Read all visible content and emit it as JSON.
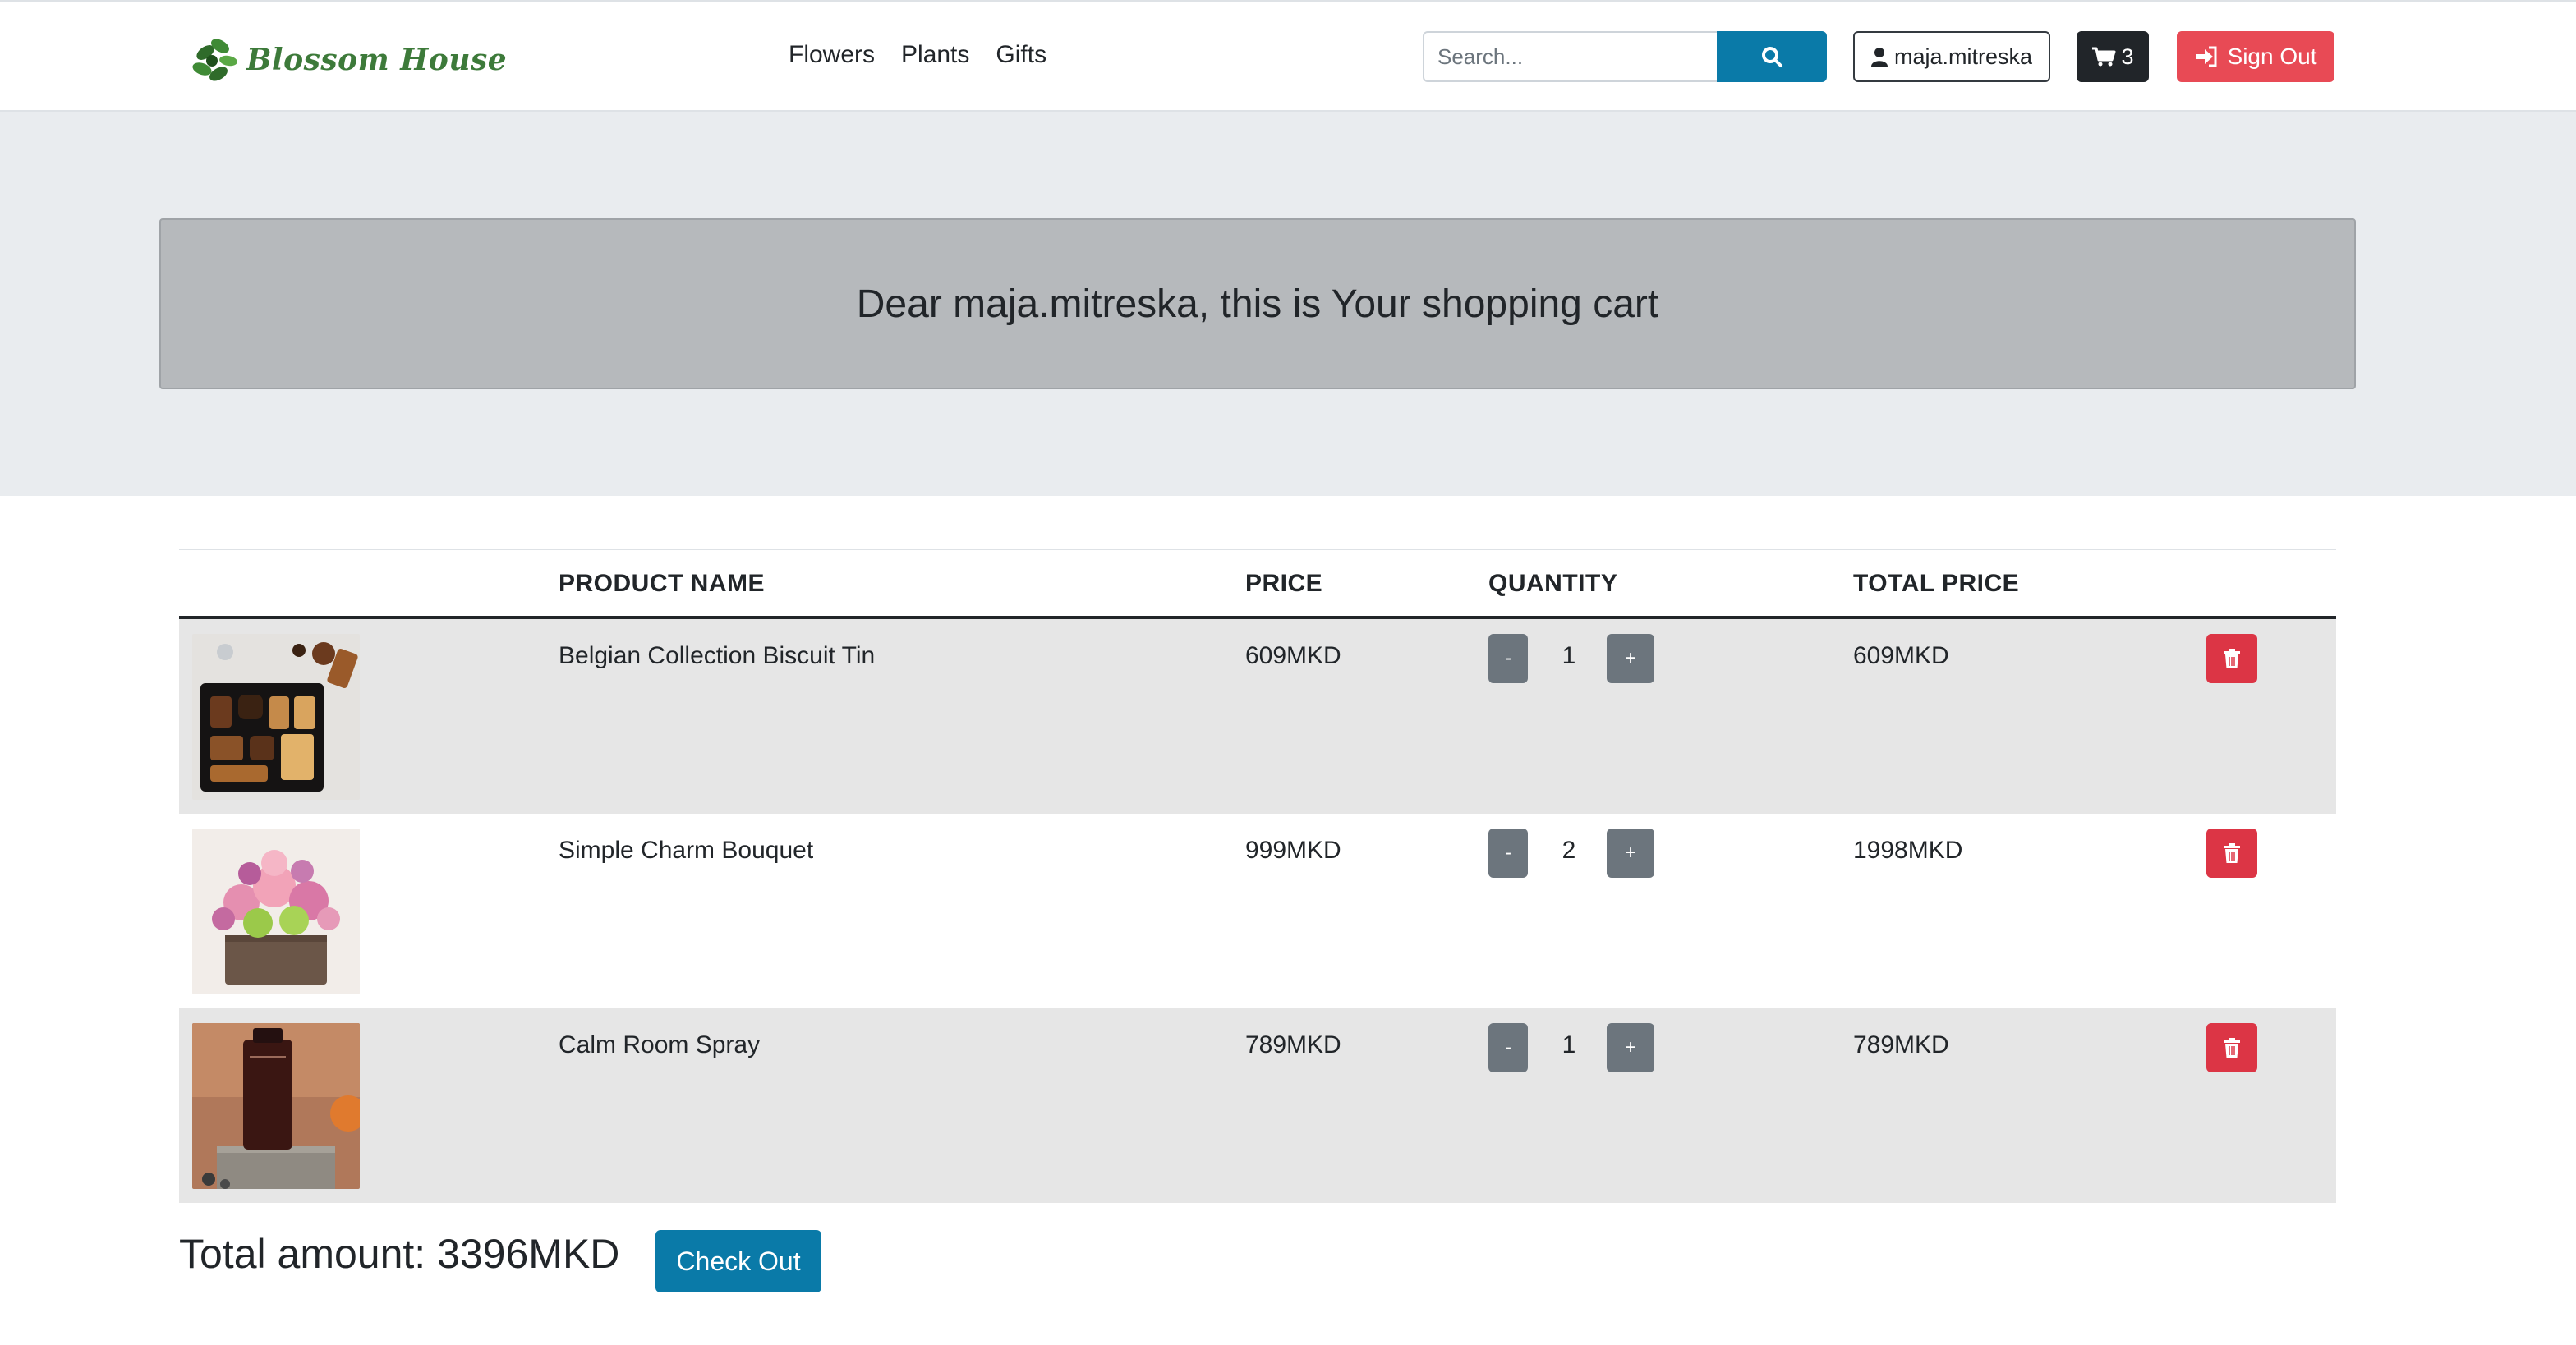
{
  "brand": {
    "name": "Blossom House"
  },
  "nav": {
    "links": [
      "Flowers",
      "Plants",
      "Gifts"
    ]
  },
  "search": {
    "placeholder": "Search...",
    "value": ""
  },
  "user": {
    "username": "maja.mitreska"
  },
  "cart_badge": {
    "count": "3"
  },
  "auth": {
    "sign_out_label": "Sign Out"
  },
  "hero": {
    "title": "Dear maja.mitreska, this is Your shopping cart"
  },
  "table": {
    "headers": [
      "PRODUCT NAME",
      "PRICE",
      "QUANTITY",
      "TOTAL PRICE"
    ],
    "rows": [
      {
        "name": "Belgian Collection Biscuit Tin",
        "price": "609MKD",
        "quantity": "1",
        "total": "609MKD",
        "image": "biscuit-tin"
      },
      {
        "name": "Simple Charm Bouquet",
        "price": "999MKD",
        "quantity": "2",
        "total": "1998MKD",
        "image": "flower-bouquet"
      },
      {
        "name": "Calm Room Spray",
        "price": "789MKD",
        "quantity": "1",
        "total": "789MKD",
        "image": "room-spray-bottle"
      }
    ],
    "minus_label": "-",
    "plus_label": "+"
  },
  "summary": {
    "total_label": "Total amount: 3396MKD",
    "checkout_label": "Check Out"
  },
  "colors": {
    "primary": "#0a7aa8",
    "danger": "#dc3545",
    "signout": "#e84a55",
    "dark": "#212529",
    "secondary": "#6c757d"
  },
  "icons": [
    "search-icon",
    "user-icon",
    "cart-icon",
    "sign-out-icon",
    "trash-icon"
  ]
}
